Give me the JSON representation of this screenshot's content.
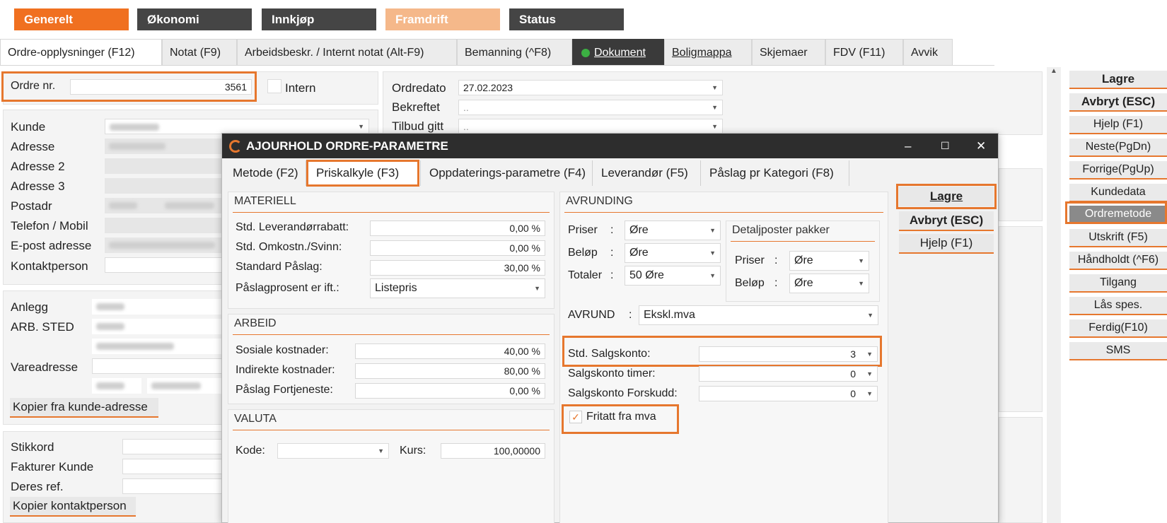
{
  "top_modules": [
    {
      "label": "Generelt",
      "color": "#f07020"
    },
    {
      "label": "Økonomi",
      "color": "#454545"
    },
    {
      "label": "Innkjøp",
      "color": "#454545"
    },
    {
      "label": "Framdrift",
      "color": "#f5b88a"
    },
    {
      "label": "Status",
      "color": "#454545"
    }
  ],
  "tabs": [
    {
      "label": "Ordre-opplysninger (F12)"
    },
    {
      "label": "Notat (F9)"
    },
    {
      "label": "Arbeidsbeskr. / Internt notat (Alt-F9)"
    },
    {
      "label": "Bemanning (^F8)"
    },
    {
      "label": "Dokument"
    },
    {
      "label": "Boligmappa"
    },
    {
      "label": "Skjemaer"
    },
    {
      "label": "FDV (F11)"
    },
    {
      "label": "Avvik"
    }
  ],
  "order": {
    "label": "Ordre nr.",
    "value": "3561",
    "intern_label": "Intern"
  },
  "dates": {
    "ordredato_label": "Ordredato",
    "ordredato_value": "27.02.2023",
    "bekreftet_label": "Bekreftet",
    "bekreftet_value": "..",
    "tilbud_label": "Tilbud gitt",
    "tilbud_value": ".."
  },
  "customer_labels": [
    "Kunde",
    "Adresse",
    "Adresse 2",
    "Adresse 3",
    "Postadr",
    "Telefon / Mobil",
    "E-post adresse",
    "Kontaktperson"
  ],
  "site_labels": {
    "anlegg": "Anlegg",
    "arb_sted": "ARB. STED",
    "vareadresse": "Vareadresse",
    "copy_button": "Kopier fra kunde-adresse"
  },
  "misc_labels": {
    "stikkord": "Stikkord",
    "fakturer": "Fakturer Kunde",
    "deres_ref": "Deres ref.",
    "copy_contact": "Kopier kontaktperson"
  },
  "right_buttons": [
    {
      "label": "Lagre"
    },
    {
      "label": "Avbryt (ESC)"
    },
    {
      "label": "Hjelp (F1)"
    },
    {
      "label": "Neste(PgDn)"
    },
    {
      "label": "Forrige(PgUp)"
    },
    {
      "label": "Kundedata"
    },
    {
      "label": "Ordremetode"
    },
    {
      "label": "Utskrift (F5)"
    },
    {
      "label": "Håndholdt (^F6)"
    },
    {
      "label": "Tilgang"
    },
    {
      "label": "Lås spes."
    },
    {
      "label": "Ferdig(F10)"
    },
    {
      "label": "SMS"
    }
  ],
  "dialog": {
    "title": "AJOURHOLD ORDRE-PARAMETRE",
    "tabs": [
      {
        "label": "Metode (F2)"
      },
      {
        "label": "Priskalkyle (F3)"
      },
      {
        "label": "Oppdaterings-parametre (F4)"
      },
      {
        "label": "Leverandør (F5)"
      },
      {
        "label": "Påslag pr Kategori (F8)"
      }
    ],
    "materiell": {
      "heading": "MATERIELL",
      "rows": [
        {
          "label": "Std. Leverandørrabatt:",
          "value": "0,00 %"
        },
        {
          "label": "Std. Omkostn./Svinn:",
          "value": "0,00 %"
        },
        {
          "label": "Standard Påslag:",
          "value": "30,00 %"
        }
      ],
      "paslag_label": "Påslagprosent er ift.:",
      "paslag_value": "Listepris"
    },
    "arbeid": {
      "heading": "ARBEID",
      "rows": [
        {
          "label": "Sosiale kostnader:",
          "value": "40,00 %"
        },
        {
          "label": "Indirekte kostnader:",
          "value": "80,00 %"
        },
        {
          "label": "Påslag Fortjeneste:",
          "value": "0,00 %"
        }
      ]
    },
    "valuta": {
      "heading": "VALUTA",
      "kode_label": "Kode:",
      "kode_value": "",
      "kurs_label": "Kurs:",
      "kurs_value": "100,00000"
    },
    "avrunding": {
      "heading": "AVRUNDING",
      "priser_label": "Priser",
      "priser_value": "Øre",
      "belop_label": "Beløp",
      "belop_value": "Øre",
      "totaler_label": "Totaler",
      "totaler_value": "50 Øre",
      "colon": ":",
      "detalj_heading": "Detaljposter pakker",
      "detalj_priser_label": "Priser",
      "detalj_priser_value": "Øre",
      "detalj_belop_label": "Beløp",
      "detalj_belop_value": "Øre",
      "avrund_label": "AVRUND",
      "avrund_value": "Ekskl.mva",
      "salgskonto_label": "Std. Salgskonto:",
      "salgskonto_value": "3",
      "timer_label": "Salgskonto timer:",
      "timer_value": "0",
      "forskudd_label": "Salgskonto Forskudd:",
      "forskudd_value": "0",
      "fritatt_label": "Fritatt fra mva"
    },
    "buttons": {
      "save": "Lagre",
      "cancel": "Avbryt (ESC)",
      "help": "Hjelp (F1)"
    },
    "controls": {
      "minimize": "–",
      "maximize": "☐",
      "close": "✕"
    }
  },
  "colors": {
    "accent": "#e6772e",
    "dark": "#2d2d2d",
    "green_dot": "#3cb043"
  }
}
